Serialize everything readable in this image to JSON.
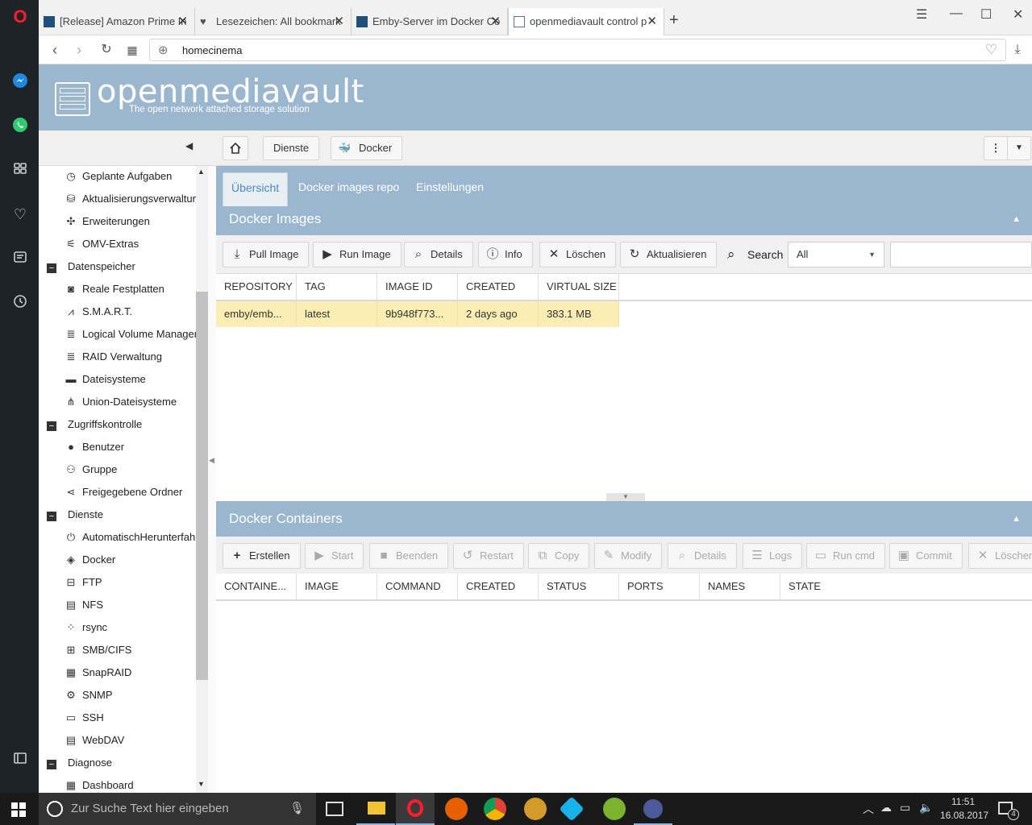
{
  "browser": {
    "tabs": [
      {
        "label": "[Release] Amazon Prime In",
        "active": false
      },
      {
        "label": "Lesezeichen: All bookmark",
        "active": false
      },
      {
        "label": "Emby-Server im Docker Co",
        "active": false
      },
      {
        "label": "openmediavault control p",
        "active": true
      }
    ],
    "address": "homecinema"
  },
  "header": {
    "title": "openmediavault",
    "subtitle": "The open network attached storage solution"
  },
  "breadcrumb": {
    "items": [
      "Dienste",
      "Docker"
    ]
  },
  "tree": {
    "items": [
      {
        "label": "Geplante Aufgaben",
        "group": false,
        "icon": "clock-icon"
      },
      {
        "label": "Aktualisierungsverwaltung",
        "group": false,
        "icon": "package-icon"
      },
      {
        "label": "Erweiterungen",
        "group": false,
        "icon": "puzzle-icon"
      },
      {
        "label": "OMV-Extras",
        "group": false,
        "icon": "plug-icon"
      },
      {
        "label": "Datenspeicher",
        "group": true,
        "icon": "minus-icon"
      },
      {
        "label": "Reale Festplatten",
        "group": false,
        "icon": "disk-icon"
      },
      {
        "label": "S.M.A.R.T.",
        "group": false,
        "icon": "chart-icon"
      },
      {
        "label": "Logical Volume Management",
        "group": false,
        "icon": "stack-icon"
      },
      {
        "label": "RAID Verwaltung",
        "group": false,
        "icon": "stack-icon"
      },
      {
        "label": "Dateisysteme",
        "group": false,
        "icon": "folder-icon"
      },
      {
        "label": "Union-Dateisysteme",
        "group": false,
        "icon": "tree-icon"
      },
      {
        "label": "Zugriffskontrolle",
        "group": true,
        "icon": "minus-icon"
      },
      {
        "label": "Benutzer",
        "group": false,
        "icon": "user-icon"
      },
      {
        "label": "Gruppe",
        "group": false,
        "icon": "users-icon"
      },
      {
        "label": "Freigegebene Ordner",
        "group": false,
        "icon": "share-icon"
      },
      {
        "label": "Dienste",
        "group": true,
        "icon": "minus-icon"
      },
      {
        "label": "AutomatischHerunterfahren",
        "group": false,
        "icon": "power-icon"
      },
      {
        "label": "Docker",
        "group": false,
        "icon": "docker-icon"
      },
      {
        "label": "FTP",
        "group": false,
        "icon": "ftp-icon"
      },
      {
        "label": "NFS",
        "group": false,
        "icon": "file-icon"
      },
      {
        "label": "rsync",
        "group": false,
        "icon": "sync-icon"
      },
      {
        "label": "SMB/CIFS",
        "group": false,
        "icon": "windows-icon"
      },
      {
        "label": "SnapRAID",
        "group": false,
        "icon": "grid-icon"
      },
      {
        "label": "SNMP",
        "group": false,
        "icon": "network-icon"
      },
      {
        "label": "SSH",
        "group": false,
        "icon": "terminal-icon"
      },
      {
        "label": "WebDAV",
        "group": false,
        "icon": "webdav-icon"
      },
      {
        "label": "Diagnose",
        "group": true,
        "icon": "minus-icon"
      },
      {
        "label": "Dashboard",
        "group": false,
        "icon": "dashboard-icon"
      }
    ]
  },
  "subtabs": [
    "Übersicht",
    "Docker images repo",
    "Einstellungen"
  ],
  "images_panel": {
    "title": "Docker Images",
    "buttons": [
      "Pull Image",
      "Run Image",
      "Details",
      "Info",
      "Löschen",
      "Aktualisieren"
    ],
    "search_label": "Search",
    "search_filter": "All",
    "columns": [
      "REPOSITORY",
      "TAG",
      "IMAGE ID",
      "CREATED",
      "VIRTUAL SIZE"
    ],
    "rows": [
      [
        "emby/emb...",
        "latest",
        "9b948f773...",
        "2 days ago",
        "383.1 MB"
      ]
    ]
  },
  "containers_panel": {
    "title": "Docker Containers",
    "buttons": [
      "Erstellen",
      "Start",
      "Beenden",
      "Restart",
      "Copy",
      "Modify",
      "Details",
      "Logs",
      "Run cmd",
      "Commit",
      "Löschen"
    ],
    "columns": [
      "CONTAINE...",
      "IMAGE",
      "COMMAND",
      "CREATED",
      "STATUS",
      "PORTS",
      "NAMES",
      "STATE"
    ]
  },
  "taskbar": {
    "search_placeholder": "Zur Suche Text hier eingeben",
    "time": "11:51",
    "date": "16.08.2017",
    "notification_count": "4"
  },
  "colors": {
    "omv_blue": "#9bb7d0",
    "selected_row": "#fbeeb4",
    "active_tab_text": "#4a8ac9"
  }
}
